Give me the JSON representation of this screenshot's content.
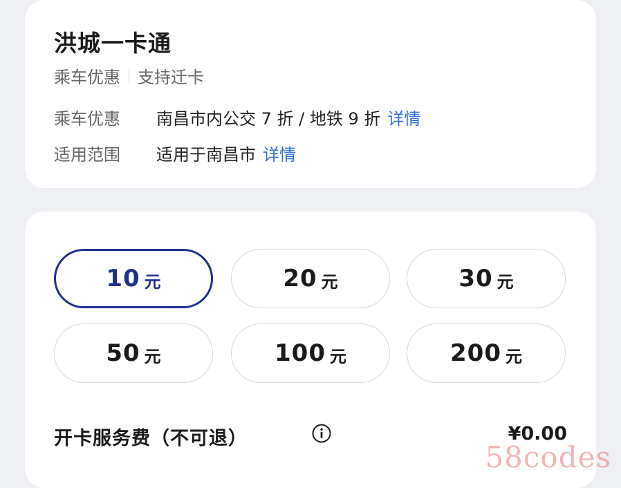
{
  "card": {
    "title": "洪城一卡通",
    "tags": [
      "乘车优惠",
      "支持迁卡"
    ],
    "rows": [
      {
        "label": "乘车优惠",
        "value": "南昌市内公交 7 折 / 地铁 9 折",
        "link": "详情"
      },
      {
        "label": "适用范围",
        "value": "适用于南昌市",
        "link": "详情"
      }
    ]
  },
  "amounts": {
    "unit": "元",
    "options": [
      {
        "value": "10",
        "selected": true
      },
      {
        "value": "20",
        "selected": false
      },
      {
        "value": "30",
        "selected": false
      },
      {
        "value": "50",
        "selected": false
      },
      {
        "value": "100",
        "selected": false
      },
      {
        "value": "200",
        "selected": false
      }
    ]
  },
  "fee": {
    "label": "开卡服务费（不可退）",
    "value": "¥0.00"
  },
  "watermark": "58codes",
  "colors": {
    "accent": "#1e2f8c",
    "link": "#2f6fd6",
    "background": "#eef0f4"
  }
}
